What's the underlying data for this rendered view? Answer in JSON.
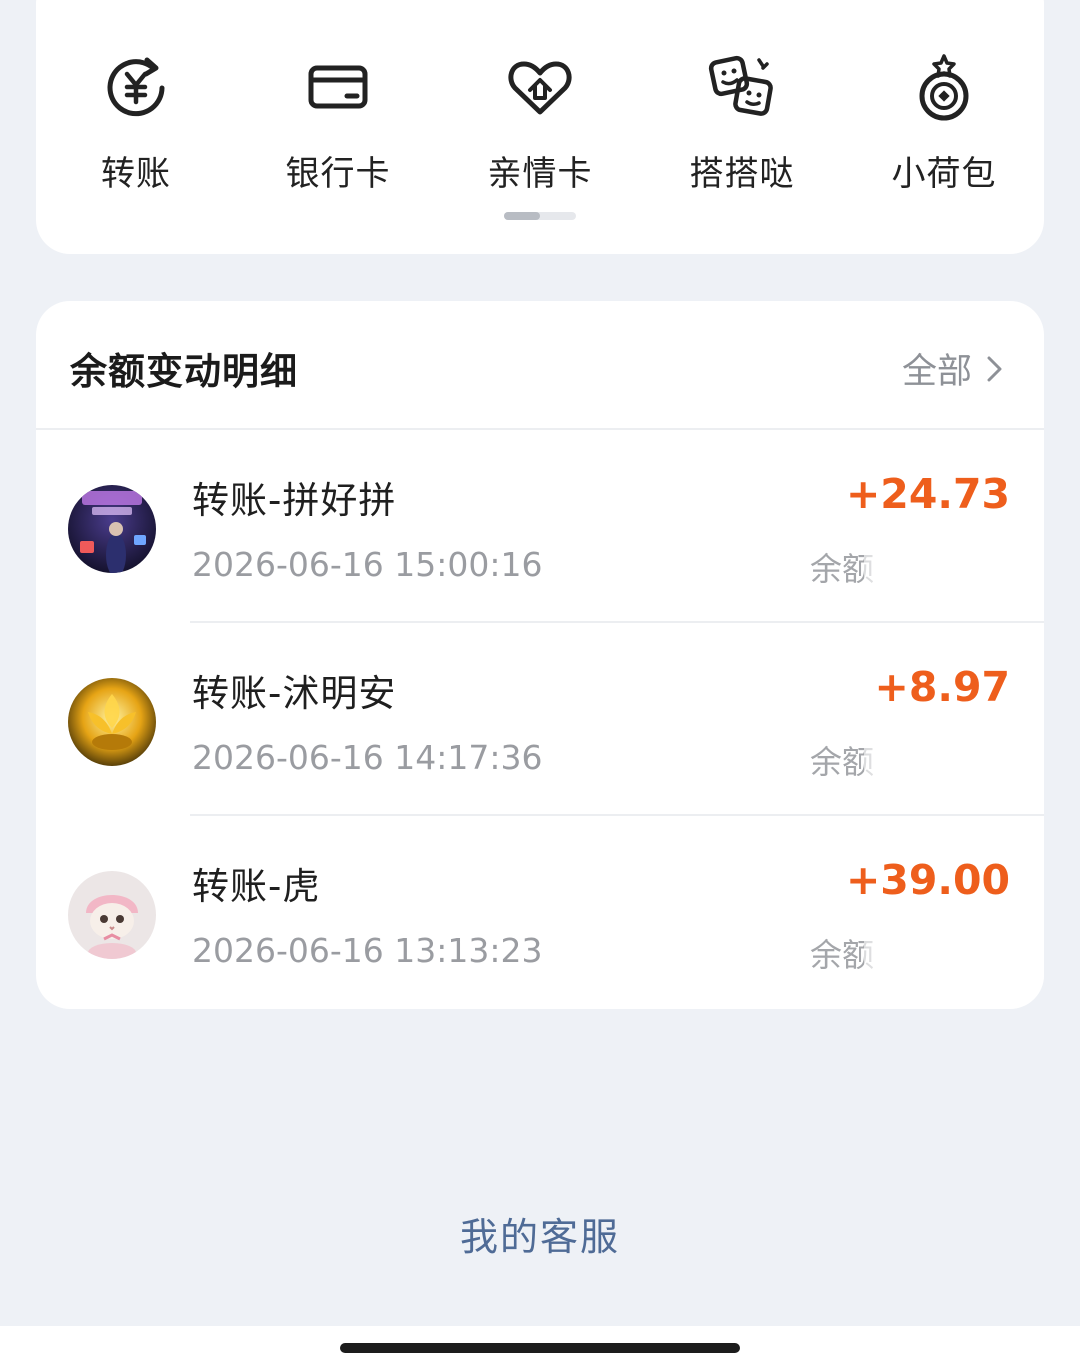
{
  "quick_actions": [
    {
      "label": "转账",
      "icon": "transfer-yuan-icon"
    },
    {
      "label": "银行卡",
      "icon": "bank-card-icon"
    },
    {
      "label": "亲情卡",
      "icon": "family-card-heart-icon"
    },
    {
      "label": "搭搭哒",
      "icon": "dadada-cards-icon"
    },
    {
      "label": "小荷包",
      "icon": "small-purse-icon"
    }
  ],
  "balance_detail": {
    "title": "余额变动明细",
    "view_all_label": "全部",
    "transactions": [
      {
        "title": "转账-拼好拼",
        "time": "2026-06-16 15:00:16",
        "amount": "+24.73",
        "balance_label": "余额"
      },
      {
        "title": "转账-沭明安",
        "time": "2026-06-16 14:17:36",
        "amount": "+8.97",
        "balance_label": "余额"
      },
      {
        "title": "转账-虎",
        "time": "2026-06-16 13:13:23",
        "amount": "+39.00",
        "balance_label": "余额"
      }
    ]
  },
  "footer": {
    "service_label": "我的客服"
  },
  "colors": {
    "accent_amount": "#ee5e1c",
    "link": "#4f6b96",
    "background": "#eef1f6"
  }
}
